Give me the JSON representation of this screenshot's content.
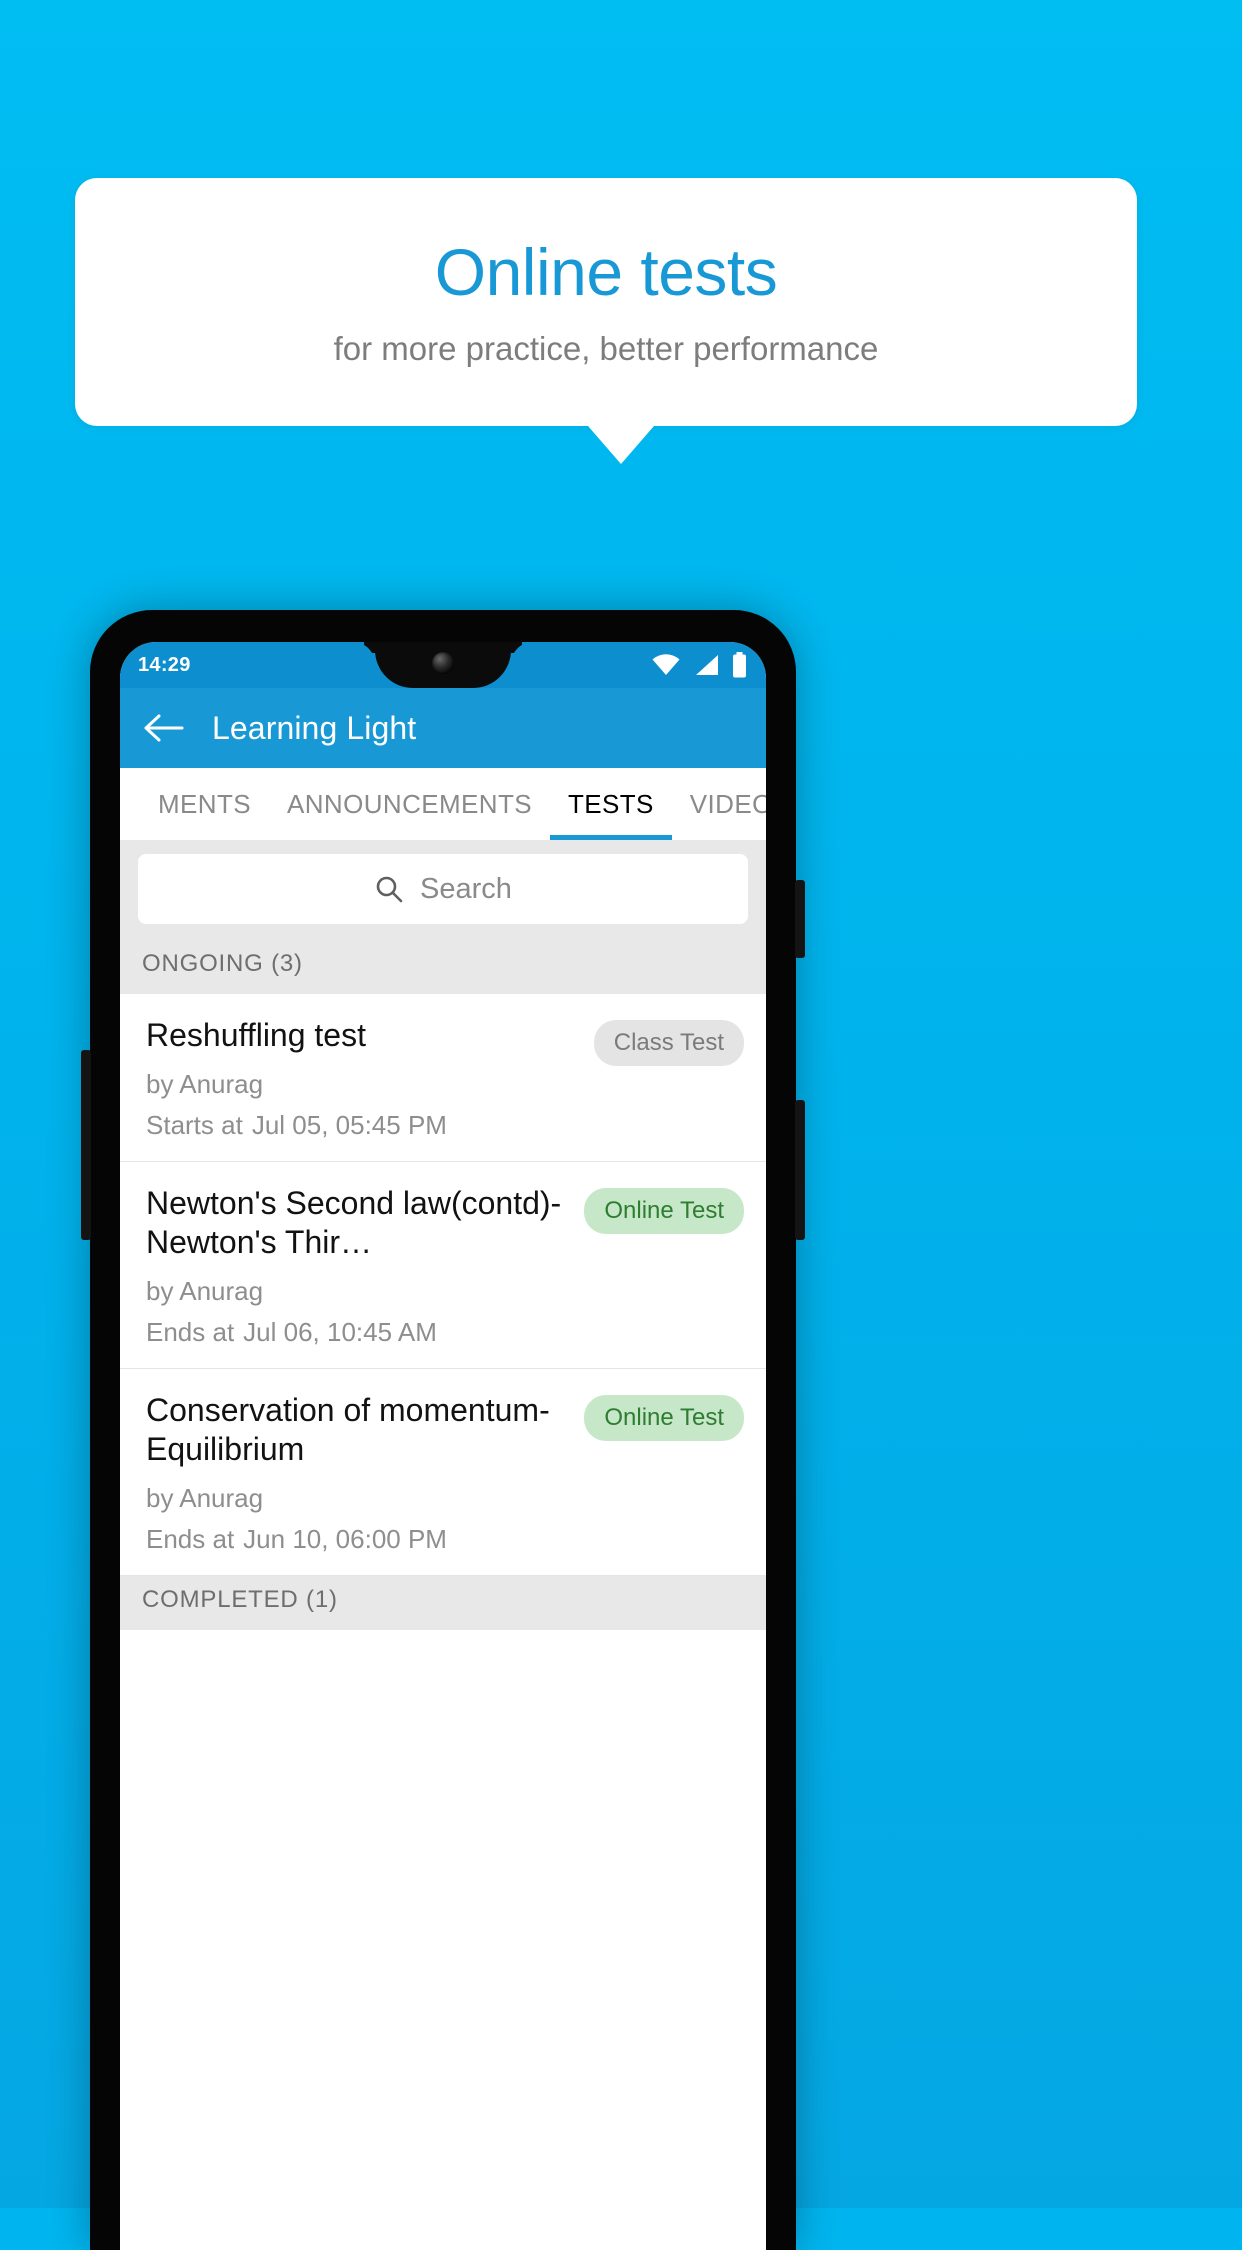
{
  "promo": {
    "title": "Online tests",
    "subtitle": "for more practice, better performance",
    "title_color": "#1899d6",
    "background_color": "#00b5ef"
  },
  "status_bar": {
    "clock": "14:29",
    "icons": [
      "wifi-icon",
      "signal-icon",
      "battery-icon"
    ]
  },
  "app_bar": {
    "back_icon": "back-arrow-icon",
    "title": "Learning Light",
    "color": "#1899d6"
  },
  "tabs": {
    "items": [
      {
        "label": "MENTS",
        "active": false
      },
      {
        "label": "ANNOUNCEMENTS",
        "active": false
      },
      {
        "label": "TESTS",
        "active": true
      },
      {
        "label": "VIDEOS",
        "active": false
      }
    ],
    "indicator_color": "#1899d6"
  },
  "search": {
    "icon": "search-icon",
    "placeholder": "Search",
    "value": ""
  },
  "sections": [
    {
      "header": "ONGOING (3)",
      "tests": [
        {
          "title": "Reshuffling test",
          "author": "by Anurag",
          "time_label": "Starts at",
          "time_value": "Jul 05, 05:45 PM",
          "badge": "Class Test",
          "badge_style": "gray"
        },
        {
          "title": "Newton's Second law(contd)-Newton's Thir…",
          "author": "by Anurag",
          "time_label": "Ends at",
          "time_value": "Jul 06, 10:45 AM",
          "badge": "Online Test",
          "badge_style": "green"
        },
        {
          "title": "Conservation of momentum-Equilibrium",
          "author": "by Anurag",
          "time_label": "Ends at",
          "time_value": "Jun 10, 06:00 PM",
          "badge": "Online Test",
          "badge_style": "green"
        }
      ]
    },
    {
      "header": "COMPLETED (1)",
      "tests": []
    }
  ],
  "colors": {
    "accent": "#1899d6",
    "status_bar": "#0d8ecf",
    "section_bg": "#e8e8e8",
    "badge_gray_bg": "#e4e4e4",
    "badge_gray_text": "#7b7b7b",
    "badge_green_bg": "#c7e7c9",
    "badge_green_text": "#2e7d32"
  }
}
